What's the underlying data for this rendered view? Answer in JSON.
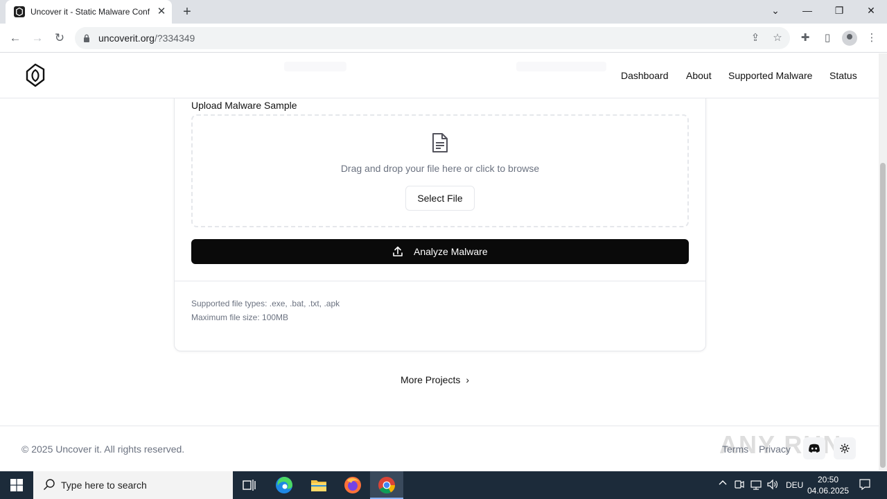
{
  "browser": {
    "tab_title": "Uncover it - Static Malware Config Extractor",
    "new_tab": "+",
    "url_host": "uncoverit.org",
    "url_path": "/?334349"
  },
  "site": {
    "nav": {
      "dashboard": "Dashboard",
      "about": "About",
      "supported_malware": "Supported Malware",
      "status": "Status"
    },
    "upload": {
      "label": "Upload Malware Sample",
      "drop_text": "Drag and drop your file here or click to browse",
      "select_button": "Select File",
      "analyze_button": "Analyze Malware",
      "supported_types": "Supported file types: .exe, .bat, .txt, .apk",
      "max_size": "Maximum file size: 100MB"
    },
    "more_projects": "More Projects",
    "footer": {
      "copyright": "© 2025 Uncover it. All rights reserved.",
      "terms": "Terms",
      "privacy": "Privacy"
    },
    "watermark": "ANY RUN"
  },
  "taskbar": {
    "search_placeholder": "Type here to search",
    "language": "DEU",
    "time": "20:50",
    "date": "04.06.2025"
  }
}
